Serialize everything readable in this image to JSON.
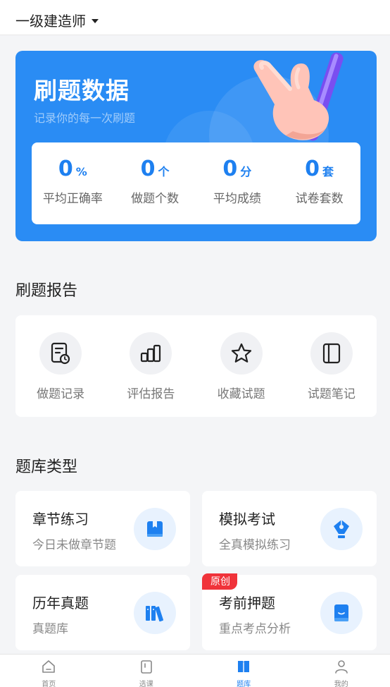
{
  "header": {
    "exam_name": "一级建造师"
  },
  "hero": {
    "title": "刷题数据",
    "subtitle": "记录你的每一次刷题",
    "stats": [
      {
        "value": "0",
        "unit": "%",
        "label": "平均正确率"
      },
      {
        "value": "0",
        "unit": "个",
        "label": "做题个数"
      },
      {
        "value": "0",
        "unit": "分",
        "label": "平均成绩"
      },
      {
        "value": "0",
        "unit": "套",
        "label": "试卷套数"
      }
    ]
  },
  "report": {
    "title": "刷题报告",
    "items": [
      {
        "label": "做题记录",
        "icon": "record-icon"
      },
      {
        "label": "评估报告",
        "icon": "chart-icon"
      },
      {
        "label": "收藏试题",
        "icon": "star-icon"
      },
      {
        "label": "试题笔记",
        "icon": "notebook-icon"
      }
    ]
  },
  "bank": {
    "title": "题库类型",
    "cards": [
      {
        "title": "章节练习",
        "subtitle": "今日未做章节题",
        "icon": "book-icon"
      },
      {
        "title": "模拟考试",
        "subtitle": "全真模拟练习",
        "icon": "pen-icon"
      },
      {
        "title": "历年真题",
        "subtitle": "真题库",
        "icon": "bookshelf-icon"
      },
      {
        "title": "考前押题",
        "subtitle": "重点考点分析",
        "icon": "booklet-icon",
        "badge": "原创"
      }
    ]
  },
  "tabbar": {
    "tabs": [
      {
        "label": "首页",
        "icon": "home-icon",
        "active": false
      },
      {
        "label": "选课",
        "icon": "course-icon",
        "active": false
      },
      {
        "label": "题库",
        "icon": "question-bank-icon",
        "active": true
      },
      {
        "label": "我的",
        "icon": "profile-icon",
        "active": false
      }
    ]
  },
  "colors": {
    "primary": "#2a8cf4",
    "accent": "#1e80f0",
    "badge": "#f0333a"
  }
}
